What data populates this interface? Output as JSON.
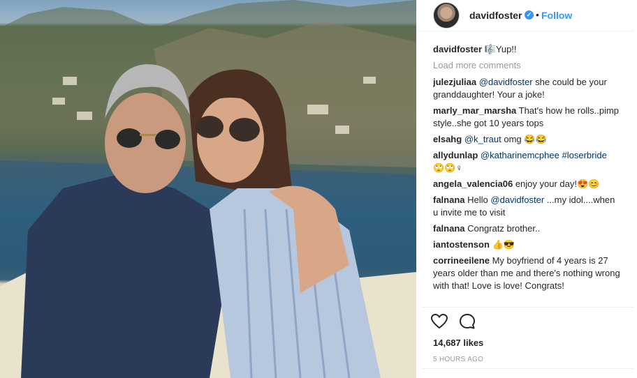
{
  "post": {
    "username": "davidfoster",
    "follow_label": "Follow",
    "dot": "•",
    "verified_glyph": "✓"
  },
  "comments": [
    {
      "user": "davidfoster",
      "text": "🎼Yup!!"
    },
    {
      "load_more": "Load more comments"
    },
    {
      "user": "julezjuliaa",
      "mention": "@davidfoster",
      "text": " she could be your granddaughter! Your a joke!"
    },
    {
      "user": "marly_mar_marsha",
      "text": "That's how he rolls..pimp style..she got 10 years tops"
    },
    {
      "user": "elsahg",
      "mention": "@k_traut",
      "text": " omg 😂😂"
    },
    {
      "user": "allydunlap",
      "mention": "@katharinemcphee",
      "hashtag": "#loserbride",
      "text": "🙄🙄♀"
    },
    {
      "user": "angela_valencia06",
      "text": "enjoy your day!😍😊"
    },
    {
      "user": "falnana",
      "text_pre": "Hello ",
      "mention": "@davidfoster",
      "text": " ...my idol....when u invite me to visit"
    },
    {
      "user": "falnana",
      "text": "Congratz brother.."
    },
    {
      "user": "iantostenson",
      "text": "👍😎"
    },
    {
      "user": "corrineeilene",
      "text": "My boyfriend of 4 years is 27 years older than me and there's nothing wrong with that! Love is love! Congrats!"
    }
  ],
  "likes": "14,687 likes",
  "time_ago": "5 HOURS AGO",
  "icons": {
    "like": "heart-icon",
    "comment": "comment-icon"
  },
  "colors": {
    "link": "#003569",
    "accent": "#3897f0",
    "muted": "#999999"
  }
}
